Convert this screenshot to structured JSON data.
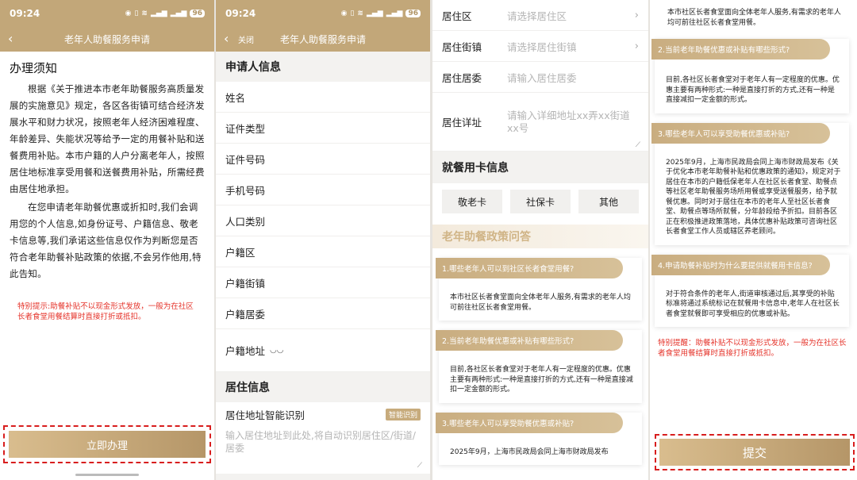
{
  "status": {
    "time": "09:24",
    "battery": "96"
  },
  "panel1": {
    "title": "老年人助餐服务申请",
    "notice_title": "办理须知",
    "para1": "根据《关于推进本市老年助餐服务高质量发展的实施意见》规定，各区各街镇可结合经济发展水平和财力状况，按照老年人经济困难程度、年龄差异、失能状况等给予一定的用餐补贴和送餐费用补贴。本市户籍的人户分离老年人，按照居住地标准享受用餐和送餐费用补贴，所需经费由居住地承担。",
    "para2": "在您申请老年助餐优惠或折扣时,我们会调用您的个人信息,如身份证号、户籍信息、敬老卡信息等,我们承诺这些信息仅作为判断您是否符合老年助餐补贴政策的依据,不会另作他用,特此告知。",
    "warning": "特别提示:助餐补贴不以现金形式发放，一般为在社区长者食堂用餐结算时直接打折或抵扣。",
    "apply_button": "立即办理"
  },
  "panel2": {
    "close_label": "关闭",
    "title": "老年人助餐服务申请",
    "applicant_section": "申请人信息",
    "fields": [
      "姓名",
      "证件类型",
      "证件号码",
      "手机号码",
      "人口类别",
      "户籍区",
      "户籍街镇",
      "户籍居委",
      "户籍地址"
    ],
    "residence_section": "居住信息",
    "smart_label": "居住地址智能识别",
    "smart_tag": "智能识别",
    "smart_placeholder": "输入居住地址到此处,将自动识别居住区/街道/居委"
  },
  "panel3": {
    "rows": [
      {
        "label": "居住区",
        "placeholder": "请选择居住区"
      },
      {
        "label": "居住街镇",
        "placeholder": "请选择居住街镇"
      },
      {
        "label": "居住居委",
        "placeholder": "请输入居住居委"
      },
      {
        "label": "居住详址",
        "placeholder": "请输入详细地址xx弄xx街道xx号"
      }
    ],
    "card_section": "就餐用卡信息",
    "card_options": [
      "敬老卡",
      "社保卡",
      "其他"
    ],
    "policy_banner": "老年助餐政策问答",
    "qa": [
      {
        "q": "1.哪些老年人可以到社区长者食堂用餐?",
        "a": "本市社区长者食堂面向全体老年人服务,有需求的老年人均可前往社区长者食堂用餐。"
      },
      {
        "q": "2.当前老年助餐优惠或补贴有哪些形式?",
        "a": "目前,各社区长者食堂对于老年人有一定程度的优惠。优惠主要有两种形式:一种是直接打折的方式,还有一种是直接减扣一定金额的形式。"
      },
      {
        "q": "3.哪些老年人可以享受助餐优惠或补贴?",
        "a": "2025年9月，上海市民政局会同上海市财政局发布"
      }
    ]
  },
  "panel4": {
    "top_text": "本市社区长者食堂面向全体老年人服务,有需求的老年人均可前往社区长者食堂用餐。",
    "qa": [
      {
        "q": "2.当前老年助餐优惠或补贴有哪些形式?",
        "a": "目前,各社区长者食堂对于老年人有一定程度的优惠。优惠主要有两种形式:一种是直接打折的方式,还有一种是直接减扣一定金额的形式。"
      },
      {
        "q": "3.哪些老年人可以享受助餐优惠或补贴?",
        "a": "2025年9月，上海市民政局会同上海市财政局发布《关于优化本市老年助餐补贴和优惠政策的通知》，规定对于居住在本市的户籍低保老年人在社区长者食堂、助餐点等社区老年助餐服务场所用餐或享受送餐服务，给予就餐优惠。同时对于居住在本市的老年人至社区长者食堂、助餐点等场所就餐，分年龄段给予折扣。目前各区正在积极推进政策落地，具体优惠补贴政策可咨询社区长者食堂工作人员或辖区养老顾问。"
      },
      {
        "q": "4.申请助餐补贴时为什么要提供就餐用卡信息?",
        "a": "对于符合条件的老年人,街道审核通过后,其享受的补贴标准将通过系统标记在就餐用卡信息中,老年人在社区长者食堂就餐即可享受相应的优惠或补贴。"
      }
    ],
    "warning": "特别提醒：助餐补贴不以现金形式发放，一般为在社区长者食堂用餐结算时直接打折或抵扣。",
    "submit_button": "提交"
  }
}
